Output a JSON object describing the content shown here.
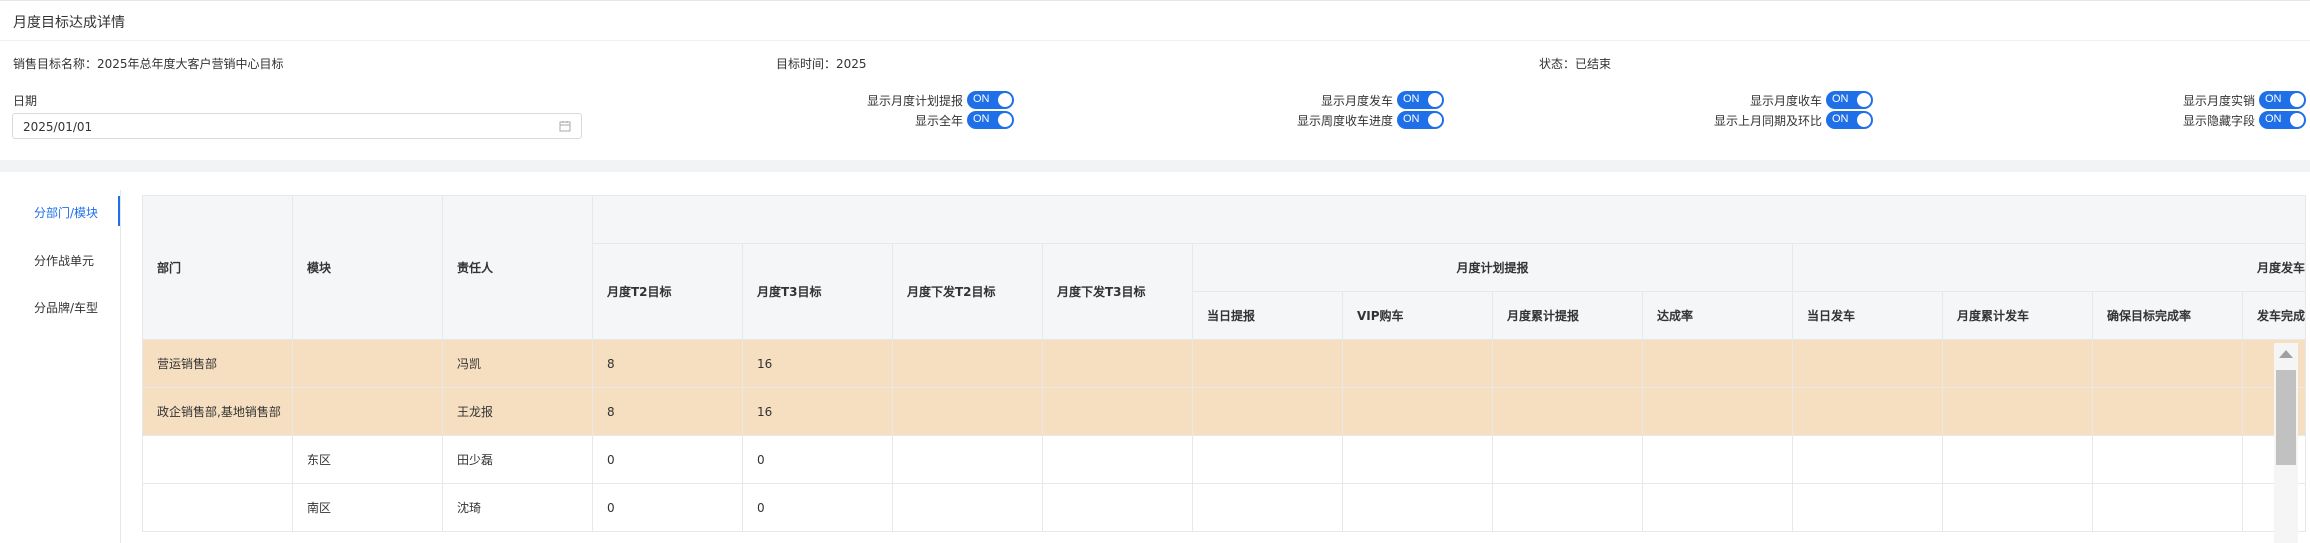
{
  "page_title": "月度目标达成详情",
  "info": {
    "target_name": "销售目标名称：2025年总年度大客户营销中心目标",
    "target_time": "目标时间：2025",
    "status": "状态：已结束"
  },
  "date": {
    "label": "日期",
    "value": "2025/01/01"
  },
  "toggles": [
    {
      "label": "显示月度计划提报",
      "state": "ON"
    },
    {
      "label": "显示全年",
      "state": "ON"
    },
    {
      "label": "显示月度发车",
      "state": "ON"
    },
    {
      "label": "显示周度收车进度",
      "state": "ON"
    },
    {
      "label": "显示月度收车",
      "state": "ON"
    },
    {
      "label": "显示上月同期及环比",
      "state": "ON"
    },
    {
      "label": "显示月度实销",
      "state": "ON"
    },
    {
      "label": "显示隐藏字段",
      "state": "ON"
    }
  ],
  "sidebar": {
    "items": [
      {
        "label": "分部门/模块"
      },
      {
        "label": "分作战单元"
      },
      {
        "label": "分品牌/车型"
      }
    ]
  },
  "table": {
    "headers": {
      "dept": "部门",
      "module": "模块",
      "owner": "责任人",
      "t2_target": "月度T2目标",
      "t3_target": "月度T3目标",
      "issued_t2": "月度下发T2目标",
      "issued_t3": "月度下发T3目标",
      "group_plan": "月度计划提报",
      "group_ship": "月度发车",
      "plan_today": "当日提报",
      "plan_vip": "VIP购车",
      "plan_cum": "月度累计提报",
      "plan_rate": "达成率",
      "ship_today": "当日发车",
      "ship_cum": "月度累计发车",
      "ship_guarantee": "确保目标完成率",
      "ship_rate": "发车完成"
    },
    "rows": [
      {
        "dept": "营运销售部",
        "module": "",
        "owner": "冯凯",
        "t2": "8",
        "t3": "16",
        "highlight": true
      },
      {
        "dept": "政企销售部,基地销售部",
        "module": "",
        "owner": "王龙报",
        "t2": "8",
        "t3": "16",
        "highlight": true
      },
      {
        "dept": "",
        "module": "东区",
        "owner": "田少磊",
        "t2": "0",
        "t3": "0",
        "highlight": false
      },
      {
        "dept": "",
        "module": "南区",
        "owner": "沈琦",
        "t2": "0",
        "t3": "0",
        "highlight": false
      }
    ]
  },
  "colors": {
    "accent": "#1e6fe8",
    "highlight_row": "#f6dfc0",
    "header_bg": "#f5f6f8"
  }
}
